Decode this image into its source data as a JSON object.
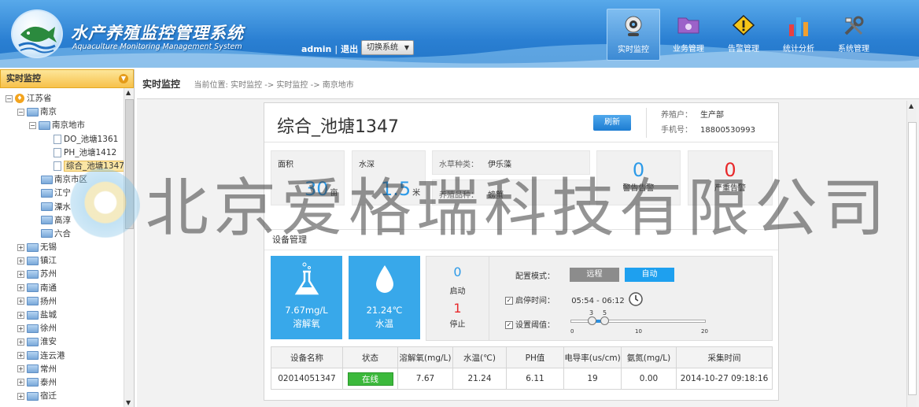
{
  "header": {
    "title": "水产养殖监控管理系统",
    "subtitle": "Aquaculture Monitoring Management System",
    "user": "admin",
    "logout": "退出",
    "switch_system": "切换系统",
    "nav": [
      {
        "label": "实时监控",
        "icon": "webcam-icon",
        "active": true
      },
      {
        "label": "业务管理",
        "icon": "folder-icon",
        "active": false
      },
      {
        "label": "告警管理",
        "icon": "warning-icon",
        "active": false
      },
      {
        "label": "统计分析",
        "icon": "bar-chart-icon",
        "active": false
      },
      {
        "label": "系统管理",
        "icon": "tools-icon",
        "active": false
      }
    ]
  },
  "sidebar": {
    "title": "实时监控",
    "tree": {
      "province": "江苏省",
      "city": "南京",
      "district": "南京地市",
      "ponds": [
        "DO_池塘1361",
        "PH_池塘1412",
        "综合_池塘1347"
      ],
      "districts": [
        "南京市区",
        "江宁",
        "溧水",
        "高淳",
        "六合"
      ],
      "cities": [
        "无锡",
        "镇江",
        "苏州",
        "南通",
        "扬州",
        "盐城",
        "徐州",
        "淮安",
        "连云港",
        "常州",
        "泰州",
        "宿迁"
      ]
    }
  },
  "breadcrumb": {
    "title": "实时监控",
    "path": "当前位置: 实时监控 -> 实时监控 -> 南京地市"
  },
  "pond": {
    "name": "综合_池塘1347",
    "refresh": "刷新",
    "owner_label": "养殖户：",
    "owner": "生产部",
    "phone_label": "手机号：",
    "phone": "18800530993"
  },
  "stats": {
    "area_label": "面积",
    "area_value": "30",
    "area_unit": "亩",
    "depth_label": "水深",
    "depth_value": "1.5",
    "depth_unit": "米",
    "weed_label": "水草种类：",
    "weed_value": "伊乐藻",
    "breed_label": "养殖品种：",
    "breed_value": "螃蟹",
    "warn_value": "0",
    "warn_label": "警告告警",
    "severe_value": "0",
    "severe_label": "严重告警"
  },
  "device": {
    "section_title": "设备管理",
    "do_value": "7.67mg/L",
    "do_label": "溶解氧",
    "temp_value": "21.24℃",
    "temp_label": "水温",
    "start_count": "0",
    "start_label": "启动",
    "stop_count": "1",
    "stop_label": "停止",
    "mode_label": "配置模式：",
    "mode_remote": "远程",
    "mode_auto": "自动",
    "time_label": "启停时间：",
    "time_value": "05:54 - 06:12",
    "threshold_label": "设置阈值：",
    "slider_low": "3",
    "slider_high": "5",
    "scale": [
      "0",
      "10",
      "20"
    ]
  },
  "table": {
    "headers": [
      "设备名称",
      "状态",
      "溶解氧(mg/L)",
      "水温(℃)",
      "PH值",
      "电导率(us/cm)",
      "氨氮(mg/L)",
      "采集时间"
    ],
    "row": [
      "02014051347",
      "在线",
      "7.67",
      "21.24",
      "6.11",
      "19",
      "0.00",
      "2014-10-27 09:18:16"
    ]
  },
  "watermark": "北京爱格瑞科技有限公司"
}
